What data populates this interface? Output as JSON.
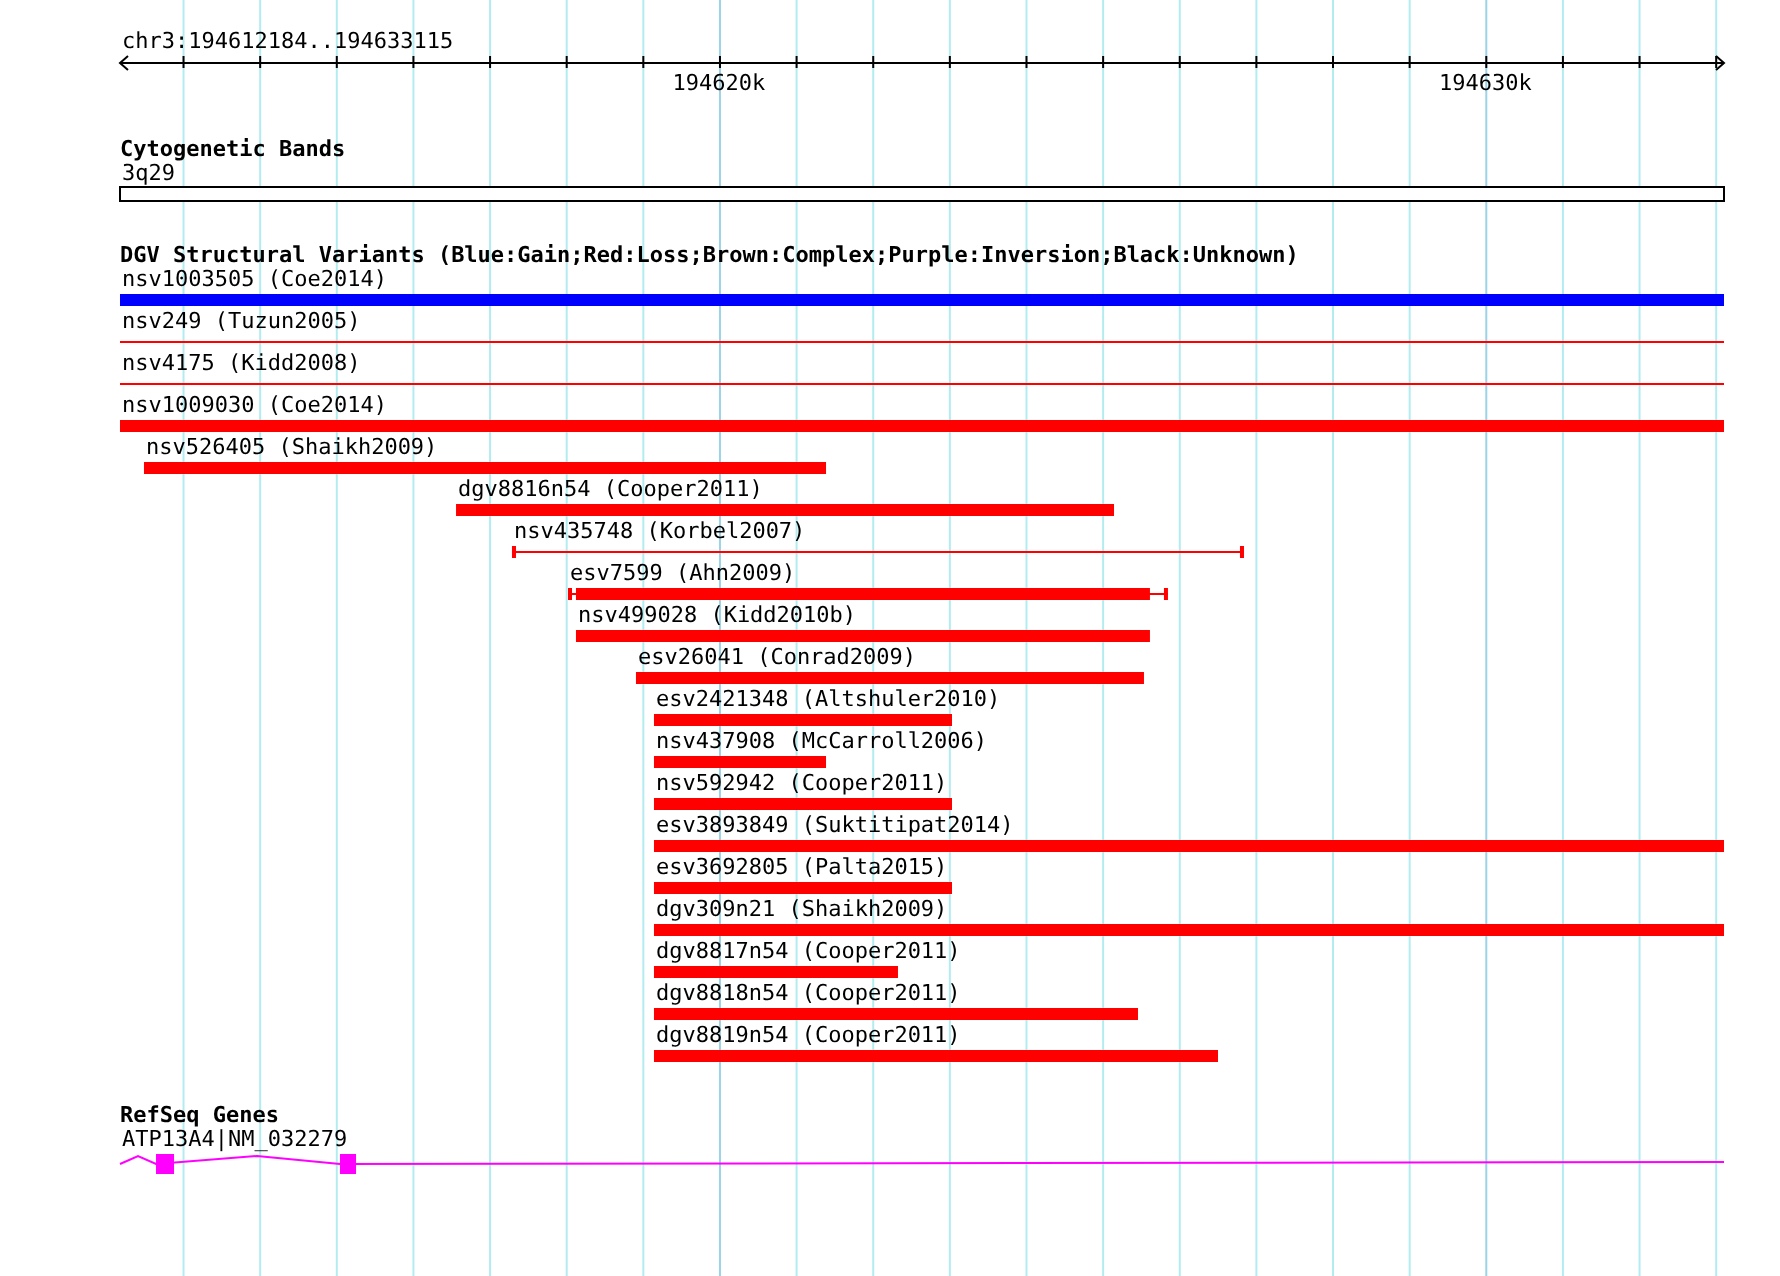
{
  "ruler": {
    "label": "chr3:194612184..194633115",
    "ticks": [
      {
        "label": "194620k"
      },
      {
        "label": "194630k"
      }
    ]
  },
  "cytobands": {
    "title": "Cytogenetic Bands",
    "band": "3q29"
  },
  "variants": {
    "title": "DGV Structural Variants (Blue:Gain;Red:Loss;Brown:Complex;Purple:Inversion;Black:Unknown)",
    "items": [
      {
        "label": "nsv1003505 (Coe2014)",
        "kind": "bar",
        "color": "#0000ff"
      },
      {
        "label": "nsv249 (Tuzun2005)",
        "kind": "line",
        "color": "#ff0000"
      },
      {
        "label": "nsv4175 (Kidd2008)",
        "kind": "line",
        "color": "#ff0000"
      },
      {
        "label": "nsv1009030 (Coe2014)",
        "kind": "bar",
        "color": "#ff0000"
      },
      {
        "label": "nsv526405 (Shaikh2009)",
        "kind": "bar",
        "color": "#ff0000"
      },
      {
        "label": "dgv8816n54 (Cooper2011)",
        "kind": "bar",
        "color": "#ff0000"
      },
      {
        "label": "nsv435748 (Korbel2007)",
        "kind": "capped",
        "color": "#ff0000"
      },
      {
        "label": "esv7599 (Ahn2009)",
        "kind": "whisker",
        "color": "#ff0000"
      },
      {
        "label": "nsv499028 (Kidd2010b)",
        "kind": "bar",
        "color": "#ff0000"
      },
      {
        "label": "esv26041 (Conrad2009)",
        "kind": "bar",
        "color": "#ff0000"
      },
      {
        "label": "esv2421348 (Altshuler2010)",
        "kind": "bar",
        "color": "#ff0000"
      },
      {
        "label": "nsv437908 (McCarroll2006)",
        "kind": "bar",
        "color": "#ff0000"
      },
      {
        "label": "nsv592942 (Cooper2011)",
        "kind": "bar",
        "color": "#ff0000"
      },
      {
        "label": "esv3893849 (Suktitipat2014)",
        "kind": "bar",
        "color": "#ff0000"
      },
      {
        "label": "esv3692805 (Palta2015)",
        "kind": "bar",
        "color": "#ff0000"
      },
      {
        "label": "dgv309n21 (Shaikh2009)",
        "kind": "bar",
        "color": "#ff0000"
      },
      {
        "label": "dgv8817n54 (Cooper2011)",
        "kind": "bar",
        "color": "#ff0000"
      },
      {
        "label": "dgv8818n54 (Cooper2011)",
        "kind": "bar",
        "color": "#ff0000"
      },
      {
        "label": "dgv8819n54 (Cooper2011)",
        "kind": "bar",
        "color": "#ff0000"
      }
    ]
  },
  "genes": {
    "title": "RefSeq Genes",
    "items": [
      {
        "label": "ATP13A4|NM_032279"
      }
    ]
  }
}
